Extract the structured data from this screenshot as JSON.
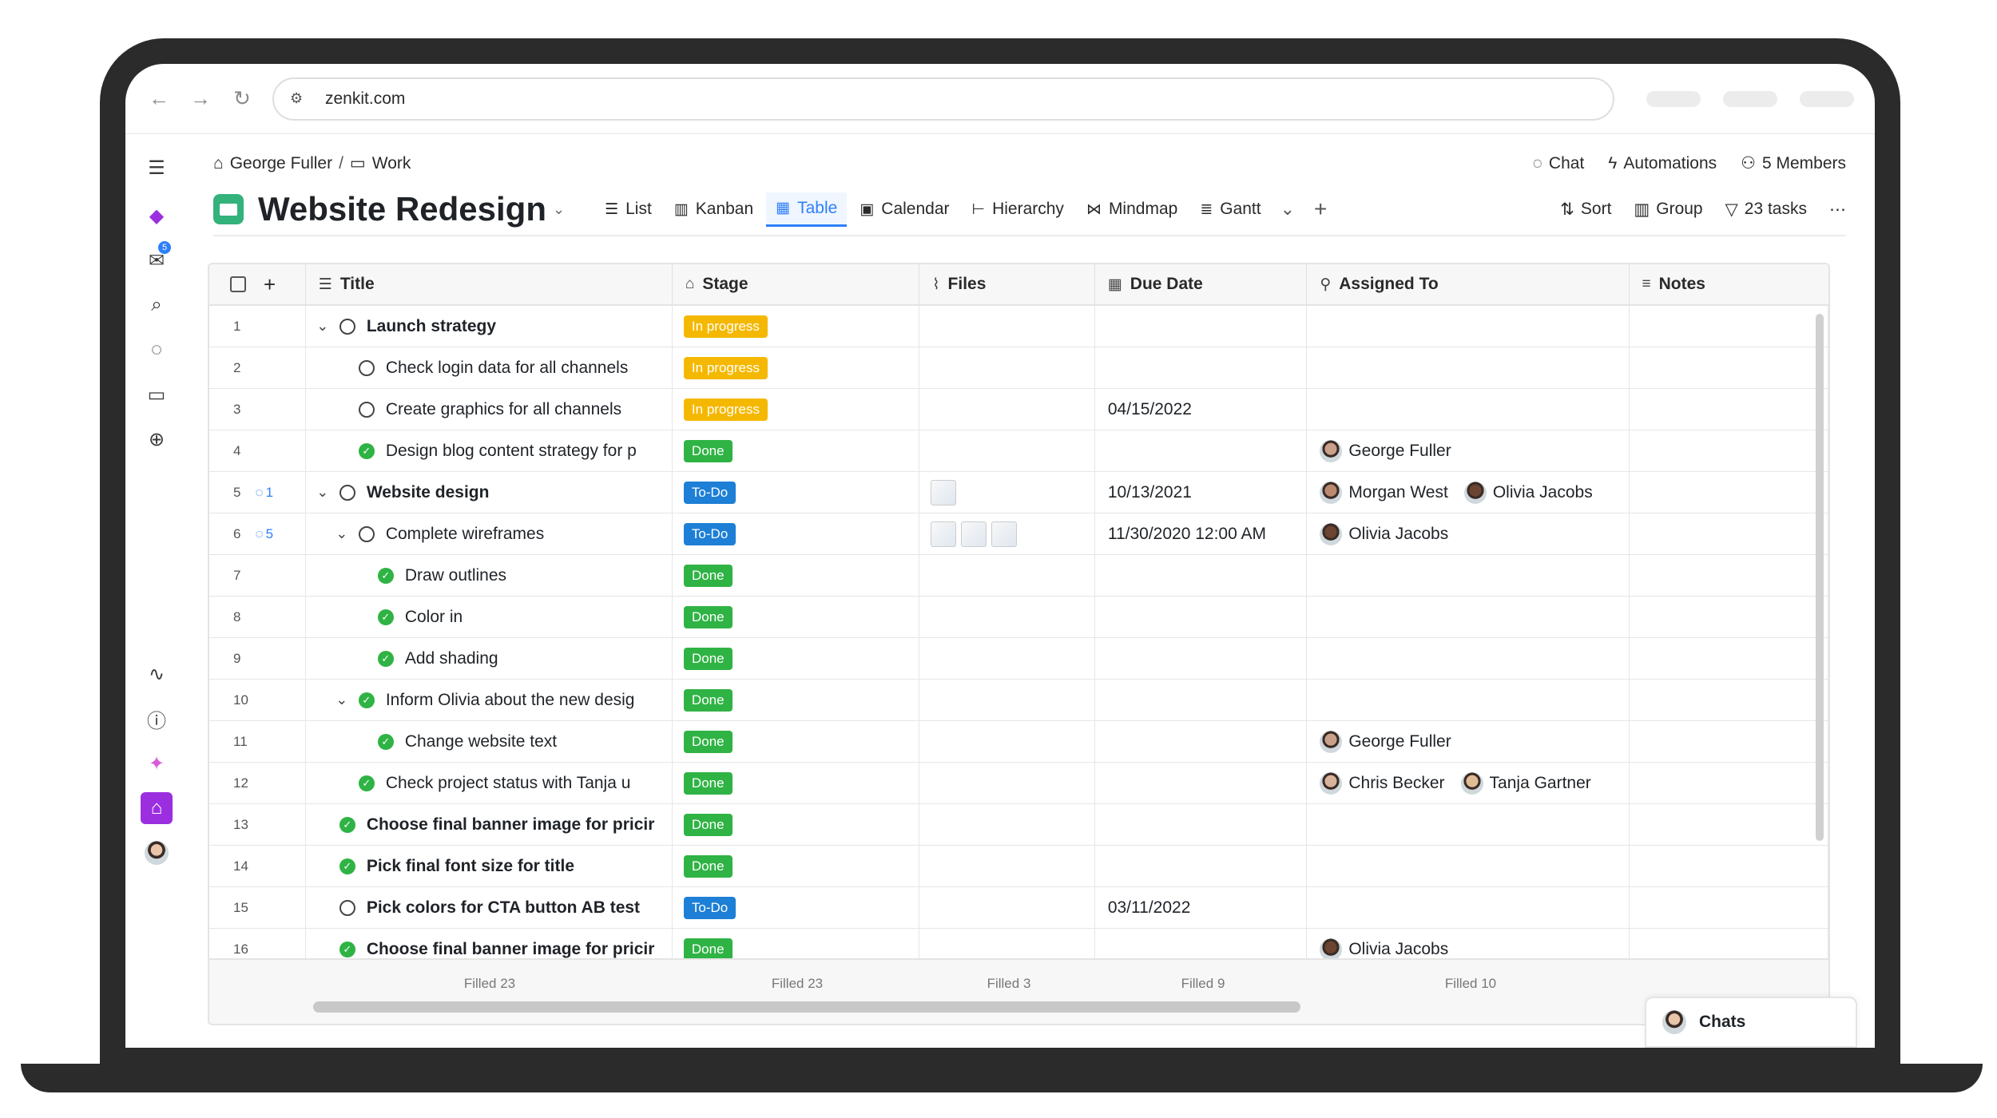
{
  "browser": {
    "url": "zenkit.com"
  },
  "rail": {
    "inbox_badge": "5"
  },
  "breadcrumb": {
    "owner": "George Fuller",
    "folder": "Work"
  },
  "top_actions": {
    "chat": "Chat",
    "automations": "Automations",
    "members": "5 Members"
  },
  "project": {
    "title": "Website Redesign"
  },
  "views": [
    {
      "label": "List",
      "icon": "list-icon"
    },
    {
      "label": "Kanban",
      "icon": "kanban-icon"
    },
    {
      "label": "Table",
      "icon": "table-icon",
      "active": true
    },
    {
      "label": "Calendar",
      "icon": "calendar-icon"
    },
    {
      "label": "Hierarchy",
      "icon": "hierarchy-icon"
    },
    {
      "label": "Mindmap",
      "icon": "mindmap-icon"
    },
    {
      "label": "Gantt",
      "icon": "gantt-icon"
    }
  ],
  "tools": {
    "sort": "Sort",
    "group": "Group",
    "tasks": "23 tasks"
  },
  "columns": {
    "title": "Title",
    "stage": "Stage",
    "files": "Files",
    "due": "Due Date",
    "assigned": "Assigned To",
    "notes": "Notes"
  },
  "stage_colors": {
    "In progress": "#f5b800",
    "To-Do": "#1d7fd6",
    "Done": "#2fb344"
  },
  "rows": [
    {
      "n": "1",
      "comments": "",
      "indent": 0,
      "expand": true,
      "status": "open",
      "bold": true,
      "title": "Launch strategy",
      "stage": "In progress",
      "files": 0,
      "due": "",
      "people": []
    },
    {
      "n": "2",
      "comments": "",
      "indent": 1,
      "expand": false,
      "status": "open",
      "bold": false,
      "title": "Check login data for all channels",
      "stage": "In progress",
      "files": 0,
      "due": "",
      "people": []
    },
    {
      "n": "3",
      "comments": "",
      "indent": 1,
      "expand": false,
      "status": "open",
      "bold": false,
      "title": "Create graphics for all channels",
      "stage": "In progress",
      "files": 0,
      "due": "04/15/2022",
      "people": []
    },
    {
      "n": "4",
      "comments": "",
      "indent": 1,
      "expand": false,
      "status": "done",
      "bold": false,
      "title": "Design blog content strategy for p",
      "stage": "Done",
      "files": 0,
      "due": "",
      "people": [
        "George Fuller"
      ]
    },
    {
      "n": "5",
      "comments": "1",
      "indent": 0,
      "expand": true,
      "status": "open",
      "bold": true,
      "title": "Website design",
      "stage": "To-Do",
      "files": 1,
      "due": "10/13/2021",
      "people": [
        "Morgan West",
        "Olivia Jacobs"
      ]
    },
    {
      "n": "6",
      "comments": "5",
      "indent": 1,
      "expand": true,
      "status": "open",
      "bold": false,
      "title": "Complete wireframes",
      "stage": "To-Do",
      "files": 3,
      "due": "11/30/2020 12:00 AM",
      "people": [
        "Olivia Jacobs"
      ]
    },
    {
      "n": "7",
      "comments": "",
      "indent": 2,
      "expand": false,
      "status": "done",
      "bold": false,
      "title": "Draw outlines",
      "stage": "Done",
      "files": 0,
      "due": "",
      "people": []
    },
    {
      "n": "8",
      "comments": "",
      "indent": 2,
      "expand": false,
      "status": "done",
      "bold": false,
      "title": "Color in",
      "stage": "Done",
      "files": 0,
      "due": "",
      "people": []
    },
    {
      "n": "9",
      "comments": "",
      "indent": 2,
      "expand": false,
      "status": "done",
      "bold": false,
      "title": "Add shading",
      "stage": "Done",
      "files": 0,
      "due": "",
      "people": []
    },
    {
      "n": "10",
      "comments": "",
      "indent": 1,
      "expand": true,
      "status": "done",
      "bold": false,
      "title": "Inform Olivia about the new desig",
      "stage": "Done",
      "files": 0,
      "due": "",
      "people": []
    },
    {
      "n": "11",
      "comments": "",
      "indent": 2,
      "expand": false,
      "status": "done",
      "bold": false,
      "title": "Change website text",
      "stage": "Done",
      "files": 0,
      "due": "",
      "people": [
        "George Fuller"
      ]
    },
    {
      "n": "12",
      "comments": "",
      "indent": 1,
      "expand": false,
      "status": "done",
      "bold": false,
      "title": "Check project status with Tanja u",
      "stage": "Done",
      "files": 0,
      "due": "",
      "people": [
        "Chris Becker",
        "Tanja Gartner"
      ]
    },
    {
      "n": "13",
      "comments": "",
      "indent": 0,
      "expand": false,
      "status": "done",
      "bold": true,
      "title": "Choose final banner image for pricir",
      "stage": "Done",
      "files": 0,
      "due": "",
      "people": []
    },
    {
      "n": "14",
      "comments": "",
      "indent": 0,
      "expand": false,
      "status": "done",
      "bold": true,
      "title": "Pick final font size for title",
      "stage": "Done",
      "files": 0,
      "due": "",
      "people": []
    },
    {
      "n": "15",
      "comments": "",
      "indent": 0,
      "expand": false,
      "status": "open",
      "bold": true,
      "title": "Pick colors for CTA button AB test",
      "stage": "To-Do",
      "files": 0,
      "due": "03/11/2022",
      "people": []
    },
    {
      "n": "16",
      "comments": "",
      "indent": 0,
      "expand": false,
      "status": "done",
      "bold": true,
      "title": "Choose final banner image for pricir",
      "stage": "Done",
      "files": 0,
      "due": "",
      "people": [
        "Olivia Jacobs"
      ]
    }
  ],
  "footer": {
    "title": "Filled 23",
    "stage": "Filled 23",
    "files": "Filled 3",
    "due": "Filled 9",
    "assigned": "Filled 10"
  },
  "chats": {
    "label": "Chats"
  }
}
